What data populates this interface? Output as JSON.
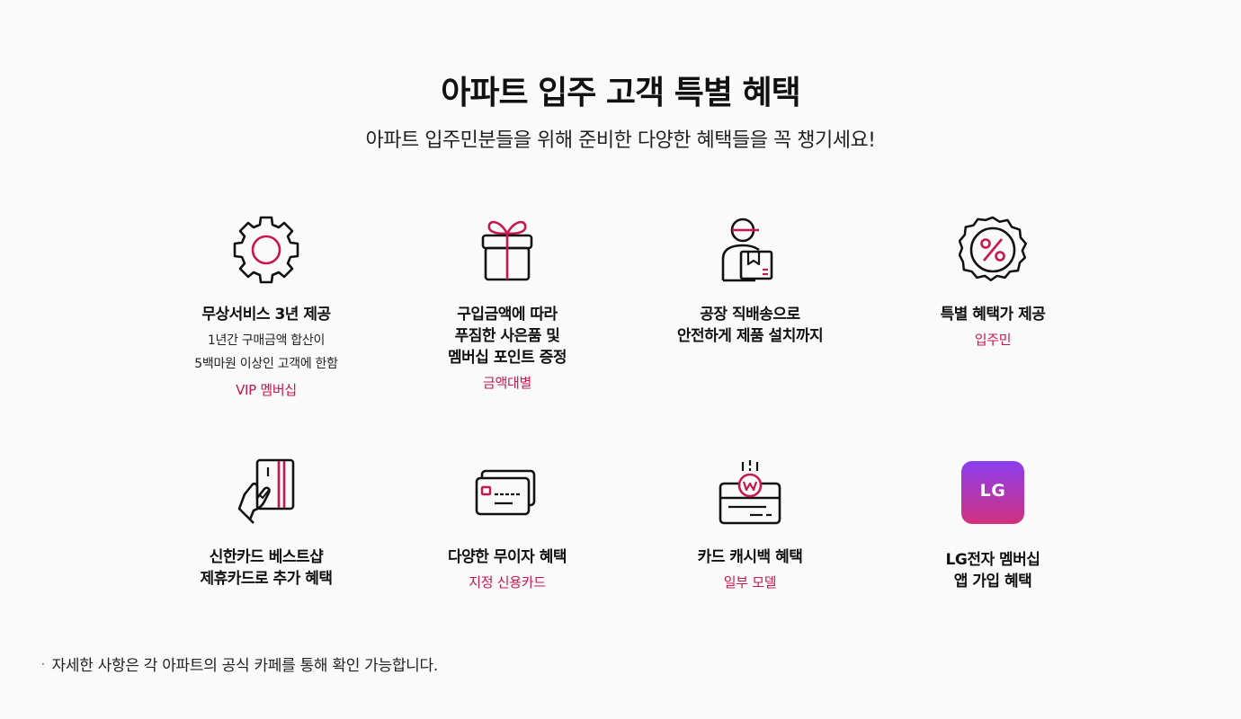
{
  "header": {
    "title": "아파트 입주 고객 특별 혜택",
    "subtitle": "아파트 입주민분들을 위해 준비한 다양한 혜택들을 꼭 챙기세요!"
  },
  "benefits": [
    {
      "icon": "gear-icon",
      "name": "무상서비스 3년 제공",
      "desc": "1년간 구매금액 합산이\n5백마원 이상인 고객에 한함",
      "tag": "VIP 멤버십"
    },
    {
      "icon": "gift-icon",
      "name": "구입금액에 따라\n푸짐한 사은품 및\n멤버십 포인트 증정",
      "tag": "금액대별"
    },
    {
      "icon": "delivery-person-icon",
      "name": "공장 직배송으로\n안전하게 제품 설치까지"
    },
    {
      "icon": "discount-badge-icon",
      "name": "특별 혜택가 제공",
      "tag": "입주민"
    },
    {
      "icon": "card-hand-icon",
      "name": "신한카드 베스트샵\n제휴카드로 추가 혜택"
    },
    {
      "icon": "credit-cards-icon",
      "name": "다양한 무이자 혜택",
      "tag": "지정 신용카드"
    },
    {
      "icon": "cashback-card-icon",
      "name": "카드 캐시백 혜택",
      "tag": "일부 모델"
    },
    {
      "icon": "lg-app-icon",
      "icon_label": "LG",
      "name": "LG전자 멤버십\n앱 가입 혜택"
    }
  ],
  "footer": {
    "bullet": "·",
    "note": "자세한 사항은 각 아파트의 공식 카페를 통해 확인 가능합니다."
  },
  "colors": {
    "accent": "#c8174f",
    "text": "#111111",
    "background": "#fafafa",
    "lg_gradient_top": "#8a3ff0",
    "lg_gradient_bottom": "#d2317e"
  }
}
